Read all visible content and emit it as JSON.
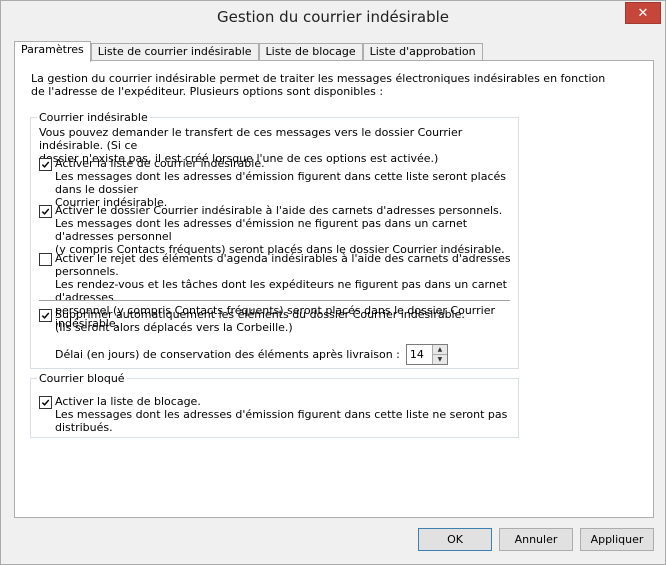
{
  "window": {
    "title": "Gestion du courrier indésirable",
    "close_glyph": "✕"
  },
  "tabs": [
    {
      "label": "Paramètres"
    },
    {
      "label": "Liste de courrier indésirable"
    },
    {
      "label": "Liste de blocage"
    },
    {
      "label": "Liste d'approbation"
    }
  ],
  "intro": {
    "line1": "La gestion du courrier indésirable permet de traiter les messages électroniques indésirables en fonction",
    "line2": "de l'adresse de l'expéditeur. Plusieurs options sont disponibles :"
  },
  "junk_group": {
    "legend": "Courrier indésirable",
    "desc_line1": "Vous pouvez demander le transfert de ces messages vers le dossier Courrier indésirable. (Si ce",
    "desc_line2": "dossier n'existe pas, il est créé lorsque l'une de ces options est activée.)",
    "options": [
      {
        "checked": true,
        "lines": [
          "Activer la liste de courrier indésirable.",
          "Les messages dont les adresses d'émission figurent dans cette liste seront placés dans le dossier",
          "Courrier indésirable."
        ]
      },
      {
        "checked": true,
        "lines": [
          "Activer le dossier Courrier indésirable à l'aide des carnets d'adresses personnels.",
          "Les messages dont les adresses d'émission ne figurent pas dans un carnet d'adresses personnel",
          "(y compris Contacts fréquents) seront placés dans le dossier Courrier indésirable."
        ]
      },
      {
        "checked": false,
        "lines": [
          "Activer le rejet des éléments d'agenda indésirables à l'aide des carnets d'adresses personnels.",
          "Les rendez-vous et les tâches dont les expéditeurs ne figurent pas dans un carnet d'adresses",
          "personnel (y compris Contacts fréquents) seront placés dans le dossier Courrier indésirable."
        ]
      },
      {
        "checked": true,
        "lines": [
          "Supprimer automatiquement les éléments du dossier Courrier indésirable.",
          "(Ils seront alors déplacés vers la Corbeille.)"
        ]
      }
    ],
    "delay_label": "Délai (en jours) de conservation des éléments après livraison :",
    "delay_value": "14"
  },
  "blocked_group": {
    "legend": "Courrier bloqué",
    "option": {
      "checked": true,
      "lines": [
        "Activer la liste de blocage.",
        "Les messages dont les adresses d'émission figurent dans cette liste ne seront pas distribués."
      ]
    }
  },
  "buttons": {
    "ok": "OK",
    "cancel": "Annuler",
    "apply": "Appliquer"
  }
}
